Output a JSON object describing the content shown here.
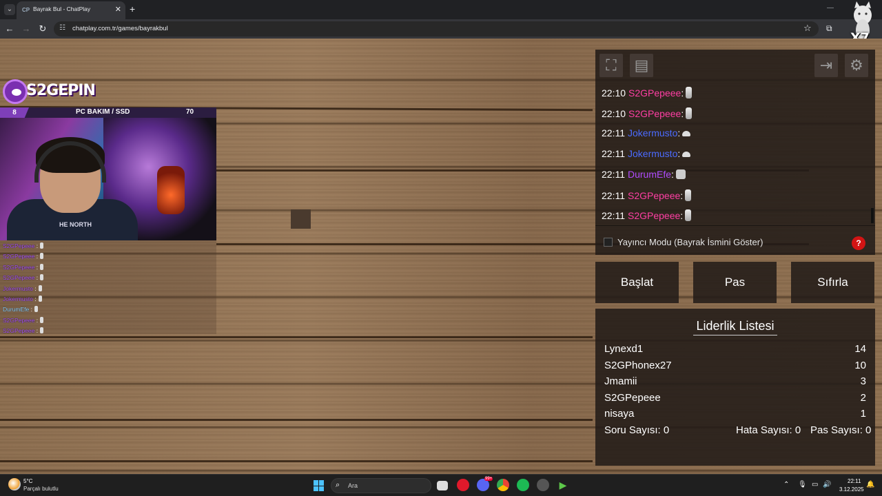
{
  "browser": {
    "tab_title": "Bayrak Bul - ChatPlay",
    "tab_favicon": "CP",
    "url": "chatplay.com.tr/games/bayrakbul",
    "overlay_badge": "X7"
  },
  "stream_overlay": {
    "logo_text": "S2GEPIN",
    "info_left": "8",
    "info_center": "PC BAKIM / SSD",
    "info_right": "70",
    "shirt_text": "HE NORTH",
    "chat": [
      {
        "name": "S2GPepeee",
        "color": "#a855f7"
      },
      {
        "name": "S2GPepeee",
        "color": "#a855f7"
      },
      {
        "name": "S2GPepeee",
        "color": "#a855f7"
      },
      {
        "name": "S2GPepeee",
        "color": "#a855f7"
      },
      {
        "name": "Jokermusto",
        "color": "#a855f7"
      },
      {
        "name": "Jokermusto",
        "color": "#a855f7"
      },
      {
        "name": "DurumEfe",
        "color": "#8fd3ff"
      },
      {
        "name": "S2GPepeee",
        "color": "#a855f7"
      },
      {
        "name": "S2GPepeee",
        "color": "#a855f7"
      }
    ]
  },
  "chat_panel": {
    "messages": [
      {
        "time": "22:10",
        "user": "S2GPepeee",
        "color": "#ff3fa4",
        "emote": "tall"
      },
      {
        "time": "22:10",
        "user": "S2GPepeee",
        "color": "#ff3fa4",
        "emote": "tall"
      },
      {
        "time": "22:11",
        "user": "Jokermusto",
        "color": "#4b6bff",
        "emote": "small"
      },
      {
        "time": "22:11",
        "user": "Jokermusto",
        "color": "#4b6bff",
        "emote": "small"
      },
      {
        "time": "22:11",
        "user": "DurumEfe",
        "color": "#b04bff",
        "emote": "cat"
      },
      {
        "time": "22:11",
        "user": "S2GPepeee",
        "color": "#ff3fa4",
        "emote": "tall"
      },
      {
        "time": "22:11",
        "user": "S2GPepeee",
        "color": "#ff3fa4",
        "emote": "tall"
      }
    ],
    "streamer_mode_label": "Yayıncı Modu (Bayrak İsmini Göster)",
    "streamer_mode_checked": false,
    "help_label": "?"
  },
  "controls": {
    "start": "Başlat",
    "pass": "Pas",
    "reset": "Sıfırla"
  },
  "leaderboard": {
    "title": "Liderlik Listesi",
    "rows": [
      {
        "name": "Lynexd1",
        "score": "14"
      },
      {
        "name": "S2GPhonex27",
        "score": "10"
      },
      {
        "name": "Jmamii",
        "score": "3"
      },
      {
        "name": "S2GPepeee",
        "score": "2"
      },
      {
        "name": "nisaya",
        "score": "1"
      }
    ],
    "question_count": "Soru Sayısı: 0",
    "error_count": "Hata Sayısı: 0",
    "pass_count": "Pas Sayısı: 0"
  },
  "taskbar": {
    "weather_temp": "5°C",
    "weather_desc": "Parçalı bulutlu",
    "search_placeholder": "Ara",
    "time": "22:11",
    "date": "3.12.2025",
    "discord_badge": "99+"
  }
}
